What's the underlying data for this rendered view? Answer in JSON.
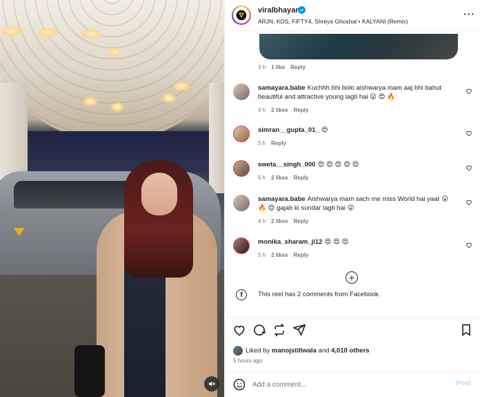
{
  "header": {
    "username": "viralbhayani",
    "music": "ARJN, KDS, FIFTY4, Shreya Ghoshal • KALYANI (Remix)",
    "more_label": "···"
  },
  "top_comment_meta": {
    "time": "3 h",
    "likes": "1 like",
    "reply": "Reply"
  },
  "comments": [
    {
      "username": "samayara.babe",
      "text": "Kuchhh bhi bolo aishwarya mam aaj bhi bahut beautiful and attractive young lagti hai 😮 😍 🔥",
      "time": "4 h",
      "likes": "2 likes",
      "reply": "Reply"
    },
    {
      "username": "simran__gupta_01_",
      "text": "😍",
      "time": "5 h",
      "likes": "",
      "reply": "Reply"
    },
    {
      "username": "sweta__singh_000",
      "text": "😍 😍 😍 😍 😍",
      "time": "5 h",
      "likes": "2 likes",
      "reply": "Reply"
    },
    {
      "username": "samayara.babe",
      "text": "Aishwarya mam sach me miss World hai yaar 😮 🔥 😍 gajab ki sundar lagti hai 😮",
      "time": "4 h",
      "likes": "2 likes",
      "reply": "Reply"
    },
    {
      "username": "monika_sharam_ji12",
      "text": "😍 😍 😍",
      "time": "5 h",
      "likes": "2 likes",
      "reply": "Reply"
    }
  ],
  "load_more_symbol": "+",
  "facebook_note": "This reel has 2 comments from Facebook.",
  "likes_summary": {
    "prefix": "Liked by ",
    "user": "manojstillwala",
    "middle": " and ",
    "others": "4,010 others"
  },
  "posted_ago": "5 hours ago",
  "add_comment": {
    "placeholder": "Add a comment...",
    "post_label": "Post"
  },
  "colors": {
    "verified": "#0095f6",
    "post_disabled": "#b3dbff",
    "muted_text": "#737373"
  }
}
